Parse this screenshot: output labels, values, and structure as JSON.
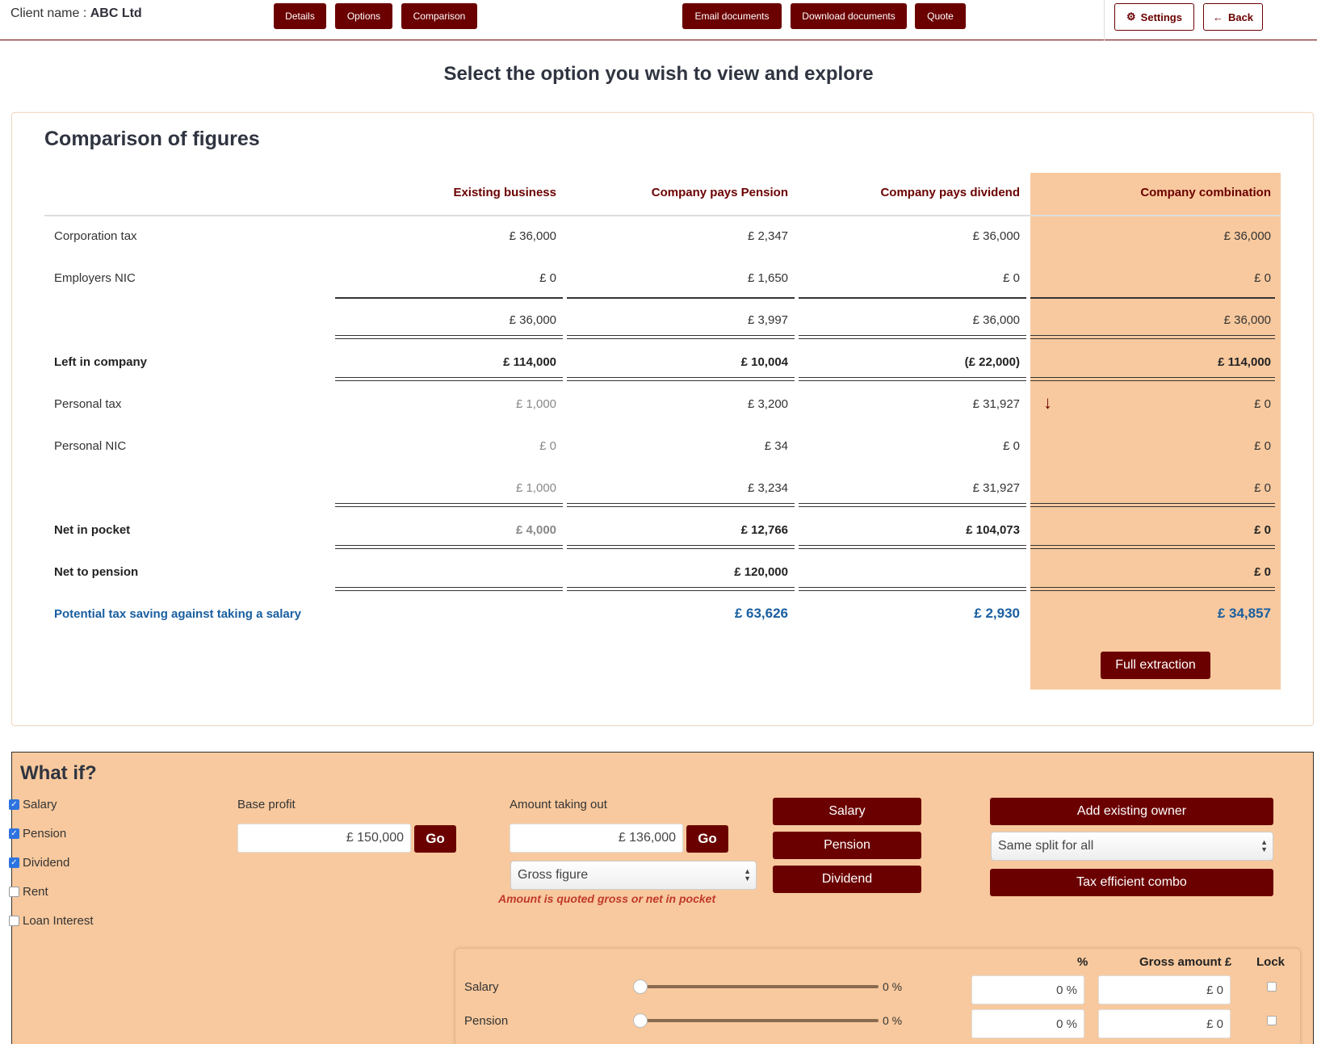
{
  "header": {
    "client_prefix": "Client name : ",
    "client_name": "ABC Ltd",
    "nav": {
      "details": "Details",
      "options": "Options",
      "comparison": "Comparison"
    },
    "actions": {
      "email": "Email documents",
      "download": "Download documents",
      "quote": "Quote"
    },
    "settings": "Settings",
    "back": "Back"
  },
  "page_heading": "Select the option you wish to view and explore",
  "comparison": {
    "title": "Comparison of figures",
    "columns": [
      "Existing business",
      "Company pays Pension",
      "Company pays dividend",
      "Company combination"
    ],
    "rows": [
      {
        "label": "Corporation tax",
        "values": [
          "£ 36,000",
          "£ 2,347",
          "£ 36,000",
          "£ 36,000"
        ]
      },
      {
        "label": "Employers NIC",
        "values": [
          "£ 0",
          "£ 1,650",
          "£ 0",
          "£ 0"
        ]
      },
      {
        "label": "",
        "values": [
          "£ 36,000",
          "£ 3,997",
          "£ 36,000",
          "£ 36,000"
        ]
      },
      {
        "label": "Left in company",
        "values": [
          "£ 114,000",
          "£ 10,004",
          "(£ 22,000)",
          "£ 114,000"
        ]
      },
      {
        "label": "Personal tax",
        "values": [
          "£ 1,000",
          "£ 3,200",
          "£ 31,927",
          "£ 0"
        ]
      },
      {
        "label": "Personal NIC",
        "values": [
          "£ 0",
          "£ 34",
          "£ 0",
          "£ 0"
        ]
      },
      {
        "label": "",
        "values": [
          "£ 1,000",
          "£ 3,234",
          "£ 31,927",
          "£ 0"
        ]
      },
      {
        "label": "Net in pocket",
        "values": [
          "£ 4,000",
          "£ 12,766",
          "£ 104,073",
          "£ 0"
        ]
      },
      {
        "label": "Net to pension",
        "values": [
          "",
          "£ 120,000",
          "",
          "£ 0"
        ]
      },
      {
        "label": "Potential tax saving against taking a salary",
        "values": [
          "",
          "£ 63,626",
          "£ 2,930",
          "£ 34,857"
        ]
      }
    ],
    "full_extraction": "Full extraction"
  },
  "whatif": {
    "title": "What if?",
    "checkboxes": [
      {
        "label": "Salary",
        "checked": true
      },
      {
        "label": "Pension",
        "checked": true
      },
      {
        "label": "Dividend",
        "checked": true
      },
      {
        "label": "Rent",
        "checked": false
      },
      {
        "label": "Loan Interest",
        "checked": false
      }
    ],
    "base_profit": {
      "label": "Base profit",
      "value": "£ 150,000",
      "go": "Go"
    },
    "amount_out": {
      "label": "Amount taking out",
      "value": "£ 136,000",
      "go": "Go"
    },
    "gross_select": "Gross figure",
    "note": "Amount is quoted gross or net in pocket",
    "buttons": {
      "salary": "Salary",
      "pension": "Pension",
      "dividend": "Dividend"
    },
    "add_owner": "Add existing owner",
    "split_select": "Same split for all",
    "tax_combo": "Tax efficient combo",
    "split": {
      "headers": {
        "pct": "%",
        "gross": "Gross amount £",
        "lock": "Lock"
      },
      "rows": [
        {
          "label": "Salary",
          "slider_pct": 0,
          "pct_text": "0 %",
          "pct_input": "0 %",
          "gross": "£ 0"
        },
        {
          "label": "Pension",
          "slider_pct": 0,
          "pct_text": "0 %",
          "pct_input": "0 %",
          "gross": "£ 0"
        }
      ]
    }
  },
  "colors": {
    "brand": "#6b0000",
    "highlight": "#f8c99e",
    "saving_blue": "#1a5fa0",
    "note_red": "#c0392b"
  }
}
